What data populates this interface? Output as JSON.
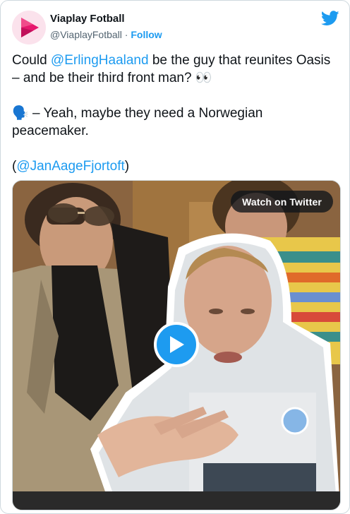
{
  "author": {
    "name": "Viaplay Fotball",
    "handle": "@ViaplayFotball",
    "separator": "·",
    "follow_label": "Follow"
  },
  "tweet": {
    "line1_prefix": "Could ",
    "mention1": "@ErlingHaaland",
    "line1_suffix": " be the guy that reunites Oasis – and be their third front man? ",
    "emoji_eyes": "👀",
    "speaking_emoji": "🗣️",
    "line2": " – Yeah, maybe they need a Norwegian peacemaker.",
    "paren_open": "(",
    "mention2": "@JanAageFjortoft",
    "paren_close": ")"
  },
  "media": {
    "watch_label": "Watch on Twitter"
  },
  "icons": {
    "brand": "twitter-bird-icon",
    "play": "play-icon"
  },
  "colors": {
    "accent": "#1d9bf0",
    "brand_pink": "#e6186e",
    "text": "#0f1419",
    "muted": "#536471"
  }
}
